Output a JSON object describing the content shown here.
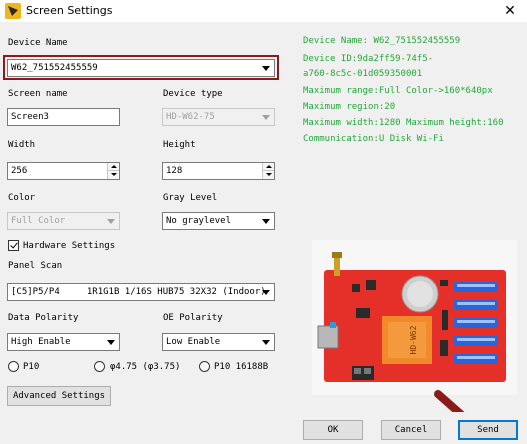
{
  "window": {
    "title": "Screen Settings",
    "close": "✕"
  },
  "device_name": {
    "label": "Device Name",
    "value": "W62_751552455559"
  },
  "screen_name": {
    "label": "Screen name",
    "value": "Screen3"
  },
  "device_type": {
    "label": "Device type",
    "value": "HD-W62-75"
  },
  "width": {
    "label": "Width",
    "value": "256"
  },
  "height": {
    "label": "Height",
    "value": "128"
  },
  "color": {
    "label": "Color",
    "value": "Full Color"
  },
  "gray_level": {
    "label": "Gray Level",
    "value": "No graylevel"
  },
  "hardware_settings": {
    "label": "Hardware Settings",
    "checked": true
  },
  "panel_scan": {
    "label": "Panel Scan",
    "value": "[C5]P5/P4     1R1G1B 1/16S HUB75 32X32 (Indoor)"
  },
  "data_polarity": {
    "label": "Data Polarity",
    "value": "High Enable"
  },
  "oe_polarity": {
    "label": "OE Polarity",
    "value": "Low Enable"
  },
  "radios": [
    "P10",
    "φ4.75 (φ3.75)",
    "P10 16188B"
  ],
  "advanced_settings": "Advanced Settings",
  "info": [
    "Device Name: W62_751552455559",
    "Device ID:9da2ff59-74f5-",
    "a760-8c5c-01d059350001",
    "Maximum range:Full Color->160*640px",
    "Maximum region:20",
    "Maximum width:1280 Maximum height:160",
    "Communication:U Disk  Wi-Fi"
  ],
  "board_label": "HD-W62",
  "buttons": {
    "ok": "OK",
    "cancel": "Cancel",
    "send": "Send"
  },
  "colors": {
    "info_text": "#22a83a",
    "highlight_border": "#8b1a1a",
    "board_red": "#e5302a",
    "send_border": "#0078d7"
  }
}
